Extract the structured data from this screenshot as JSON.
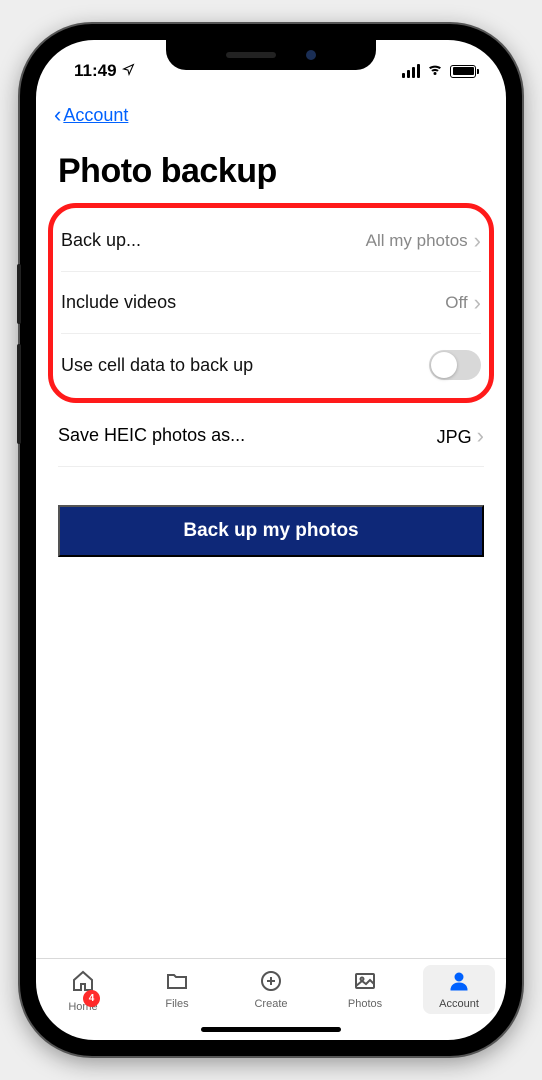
{
  "status": {
    "time": "11:49"
  },
  "nav": {
    "back_label": "Account"
  },
  "page": {
    "title": "Photo backup"
  },
  "settings": {
    "backup": {
      "label": "Back up...",
      "value": "All my photos"
    },
    "videos": {
      "label": "Include videos",
      "value": "Off"
    },
    "celldata": {
      "label": "Use cell data to back up"
    },
    "heic": {
      "label": "Save HEIC photos as...",
      "value": "JPG"
    }
  },
  "action": {
    "primary": "Back up my photos"
  },
  "tabs": {
    "home": {
      "label": "Home",
      "badge": "4"
    },
    "files": {
      "label": "Files"
    },
    "create": {
      "label": "Create"
    },
    "photos": {
      "label": "Photos"
    },
    "account": {
      "label": "Account"
    }
  }
}
